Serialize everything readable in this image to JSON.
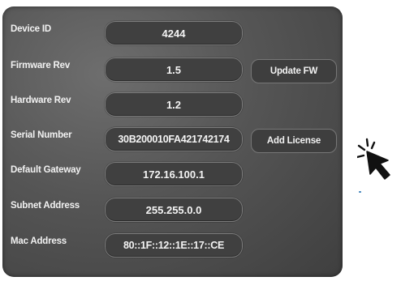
{
  "fields": [
    {
      "label": "Device ID",
      "value": "4244"
    },
    {
      "label": "Firmware Rev",
      "value": "1.5"
    },
    {
      "label": "Hardware Rev",
      "value": "1.2"
    },
    {
      "label": "Serial Number",
      "value": "30B200010FA421742174"
    },
    {
      "label": "Default Gateway",
      "value": "172.16.100.1"
    },
    {
      "label": "Subnet Address",
      "value": "255.255.0.0"
    },
    {
      "label": "Mac Address",
      "value": "80::1F::12::1E::17::CE"
    }
  ],
  "buttons": {
    "update_fw": "Update FW",
    "add_license": "Add License"
  },
  "icons": {
    "cursor": "pointer-arrow-click-icon"
  },
  "colors": {
    "panel": "#555555",
    "field": "#404040",
    "text": "#f4f4f4"
  }
}
